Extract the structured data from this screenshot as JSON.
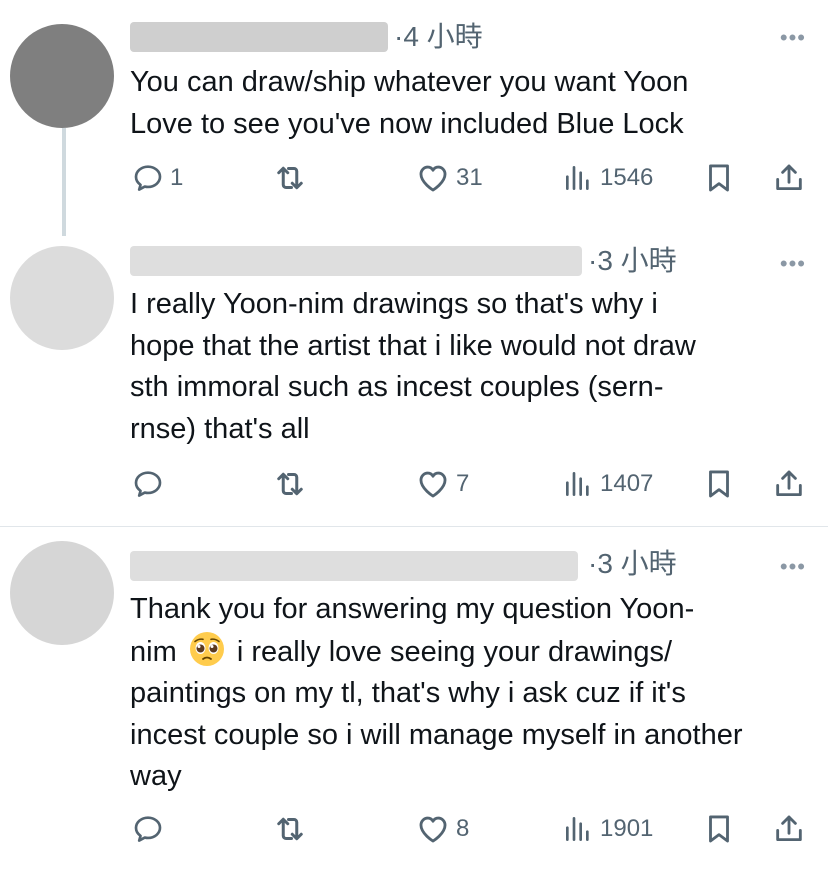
{
  "tweets": [
    {
      "timestamp": "·4 小時",
      "text": "You can draw/ship whatever you want Yoon\nLove to see you've now included Blue Lock",
      "replies": "1",
      "retweets": "",
      "likes": "31",
      "views": "1546"
    },
    {
      "timestamp": "·3 小時",
      "text": "I really Yoon-nim drawings so that's why i\nhope that the artist that i like would not draw\nsth immoral such as incest couples (sern-\nrnse) that's all",
      "replies": "",
      "retweets": "",
      "likes": "7",
      "views": "1407"
    },
    {
      "timestamp": "·3 小時",
      "text_before_emoji": "Thank you for answering my question Yoon-\nnim ",
      "text_after_emoji": " i really love seeing your drawings/\npaintings on my tl, that's why i ask cuz if it's\nincest couple so i will manage myself in another\nway",
      "emoji": "pleading-face",
      "replies": "",
      "retweets": "",
      "likes": "8",
      "views": "1901"
    }
  ],
  "icons": {
    "reply": "reply-icon",
    "retweet": "retweet-icon",
    "like": "like-icon",
    "views": "views-icon",
    "bookmark": "bookmark-icon",
    "share": "share-icon",
    "more": "more-icon"
  },
  "colors": {
    "text": "#0f1419",
    "secondary": "#536471",
    "thread_line": "#cfd9de",
    "divider": "#e1e6ea"
  }
}
